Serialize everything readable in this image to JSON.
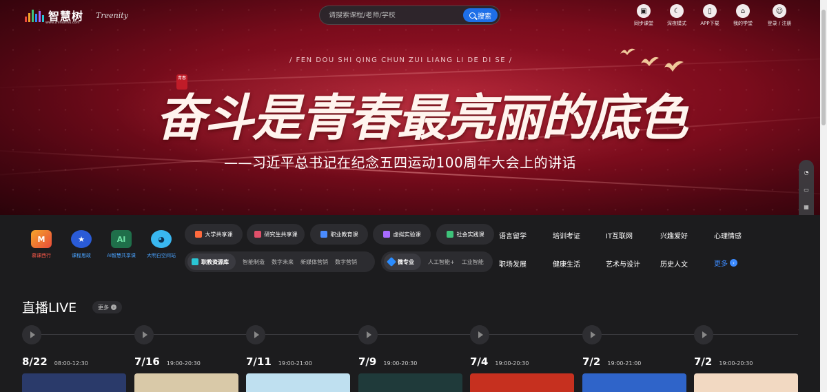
{
  "brand": {
    "name": "智慧树",
    "domain": "www.zhihuishu.com",
    "partner": "Treenity"
  },
  "search": {
    "placeholder": "请搜索课程/老师/学校",
    "button_label": "搜索"
  },
  "top_nav": [
    {
      "label": "同步课堂",
      "icon": "sync-class-icon"
    },
    {
      "label": "深夜模式",
      "icon": "night-mode-icon"
    },
    {
      "label": "APP下载",
      "icon": "phone-icon"
    },
    {
      "label": "我的学堂",
      "icon": "home-icon"
    },
    {
      "label": "登录 / 注册",
      "icon": "user-icon"
    }
  ],
  "hero": {
    "slogan_pinyin": "/ FEN DOU SHI QING CHUN ZUI LIANG LI DE DI SE /",
    "slogan": "奋斗是青春最亮丽的底色",
    "seal_text": "青春",
    "quote": "——习近平总书记在纪念五四运动100周年大会上的讲话"
  },
  "features": [
    {
      "label": "慕课西行",
      "color": "#ff5a4a"
    },
    {
      "label": "课程思政",
      "color": "#4aa3ff"
    },
    {
      "label": "AI智慧共享课",
      "color": "#4aa3ff"
    },
    {
      "label": "大明白空间站",
      "color": "#4aa3ff"
    }
  ],
  "pills_row1": [
    {
      "label": "大学共享课",
      "color": "#ff6a3d"
    },
    {
      "label": "研究生共享课",
      "color": "#e0506a"
    },
    {
      "label": "职业教育课",
      "color": "#4a8cff"
    },
    {
      "label": "虚拟实验课",
      "color": "#a86bff"
    },
    {
      "label": "社会实践课",
      "color": "#3ec37a"
    }
  ],
  "resource_pill": {
    "label": "职教资源库",
    "subs": [
      "智能制造",
      "数字未来",
      "新媒体营销",
      "数字营销"
    ]
  },
  "micro_pill": {
    "label": "微专业",
    "subs": [
      "人工智能+",
      "工业智能"
    ]
  },
  "categories_row1": [
    "语言留学",
    "培训考证",
    "IT互联网",
    "兴趣爱好",
    "心理情感"
  ],
  "categories_row2": [
    "职场发展",
    "健康生活",
    "艺术与设计",
    "历史人文"
  ],
  "more_label": "更多",
  "live": {
    "title": "直播LIVE",
    "more_label": "更多",
    "items": [
      {
        "date": "8/22",
        "time": "08:00-12:30",
        "thumb": "#2a3a6a"
      },
      {
        "date": "7/16",
        "time": "19:00-20:30",
        "thumb": "#d9c9a8"
      },
      {
        "date": "7/11",
        "time": "19:00-21:00",
        "thumb": "#bfe0f0"
      },
      {
        "date": "7/9",
        "time": "19:00-20:30",
        "thumb": "#1f3a3a"
      },
      {
        "date": "7/4",
        "time": "19:00-20:30",
        "thumb": "#c6301f"
      },
      {
        "date": "7/2",
        "time": "19:00-21:00",
        "thumb": "#2f64c9"
      },
      {
        "date": "7/2",
        "time": "19:00-20:30",
        "thumb": "#f2d9c2"
      }
    ]
  },
  "colors": {
    "accent": "#1e6fe8",
    "hero_red": "#8b0f22",
    "bg": "#1c1c1e"
  }
}
